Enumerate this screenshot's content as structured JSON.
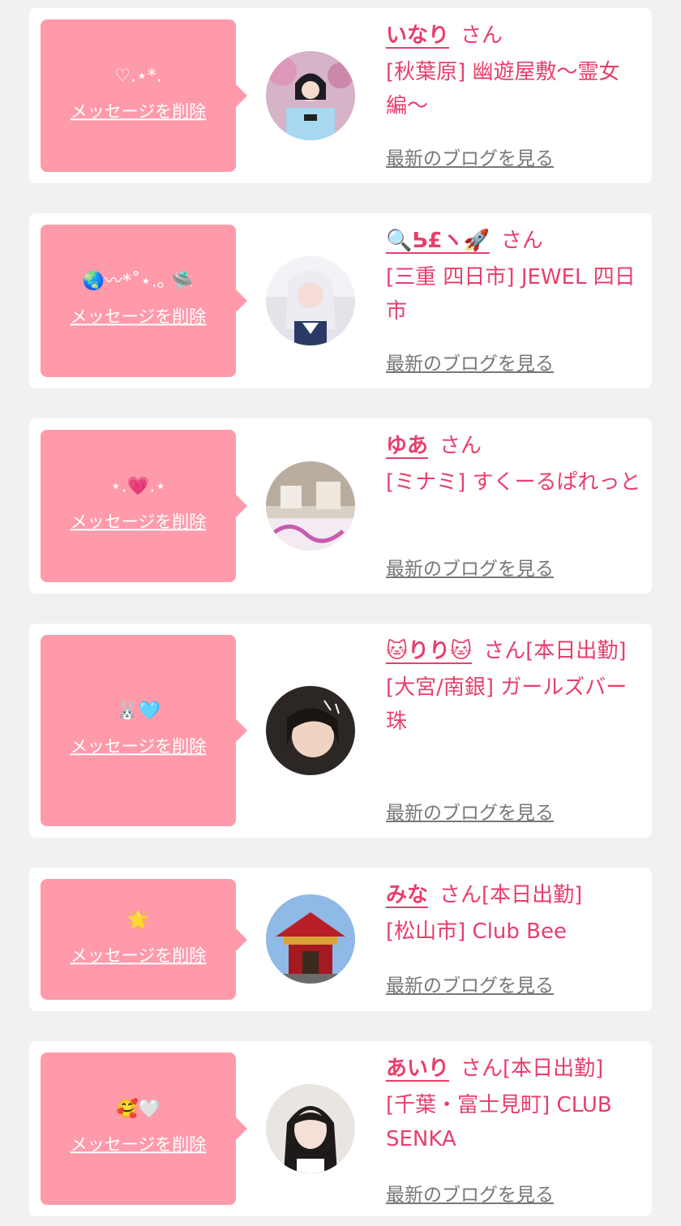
{
  "delete_label": "メッセージを削除",
  "honorific": "さん",
  "blog_label": "最新のブログを見る",
  "colors": {
    "bubble": "#ff9aab",
    "accent": "#e83e6c",
    "page_bg": "#f1f1f1",
    "card_bg": "#ffffff",
    "link_gray": "#777777"
  },
  "cards": [
    {
      "message": "♡.⋆*.",
      "name": "いなり",
      "status": "",
      "shop": "[秋葉原] 幽遊屋敷〜霊女編〜",
      "avatar_icon": "avatar-photo"
    },
    {
      "message": "🌏〰*˚⋆.｡ 🛸",
      "name": "🔍ᕊ£ヽ🚀",
      "status": "",
      "shop": "[三重 四日市] JEWEL 四日市",
      "avatar_icon": "avatar-photo"
    },
    {
      "message": "⋆.💗.⋆",
      "name": "ゆあ",
      "status": "",
      "shop": "[ミナミ] すくーるぱれっと",
      "avatar_icon": "avatar-photo"
    },
    {
      "message": "🐰🩵",
      "name": "🐱りり🐱",
      "status": "[本日出勤]",
      "shop": "[大宮/南銀] ガールズバー 珠",
      "avatar_icon": "avatar-photo"
    },
    {
      "message": "🌟",
      "name": "みな",
      "status": "[本日出勤]",
      "shop": "[松山市] Club Bee",
      "avatar_icon": "avatar-photo"
    },
    {
      "message": "🥰🤍",
      "name": "あいり",
      "status": "[本日出勤]",
      "shop": "[千葉・富士見町] CLUB SENKA",
      "avatar_icon": "avatar-photo"
    }
  ]
}
